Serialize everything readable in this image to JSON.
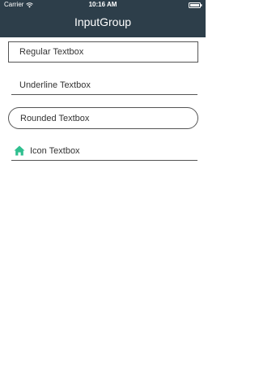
{
  "status_bar": {
    "carrier": "Carrier",
    "time": "10:16 AM",
    "icons": [
      "wifi-icon",
      "battery-icon"
    ]
  },
  "header": {
    "title": "InputGroup",
    "background_color": "#2d3e4a"
  },
  "inputs": {
    "regular": {
      "placeholder": "Regular Textbox"
    },
    "underline": {
      "placeholder": "Underline Textbox"
    },
    "rounded": {
      "placeholder": "Rounded Textbox"
    },
    "icon": {
      "placeholder": "Icon Textbox",
      "icon": "home-icon",
      "icon_color": "#2fbf8f"
    }
  }
}
